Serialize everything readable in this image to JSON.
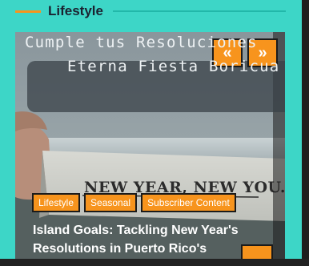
{
  "section": {
    "title": "Lifestyle"
  },
  "slider": {
    "banner_line1": "Cumple tus Resoluciones",
    "banner_line2": "Eterna Fiesta Boricua",
    "paper_text": "NEW YEAR, NEW YOU.",
    "prev_icon": "«",
    "next_icon": "»",
    "tags": [
      "Lifestyle",
      "Seasonal",
      "Subscriber Content"
    ],
    "post_title": "Island Goals: Tackling New Year's Resolutions in Puerto Rico's"
  },
  "scroll_top_icon": "︿",
  "colors": {
    "accent": "#f7941d",
    "widget_bg": "#3dd6c7",
    "heading": "#1b2230"
  }
}
